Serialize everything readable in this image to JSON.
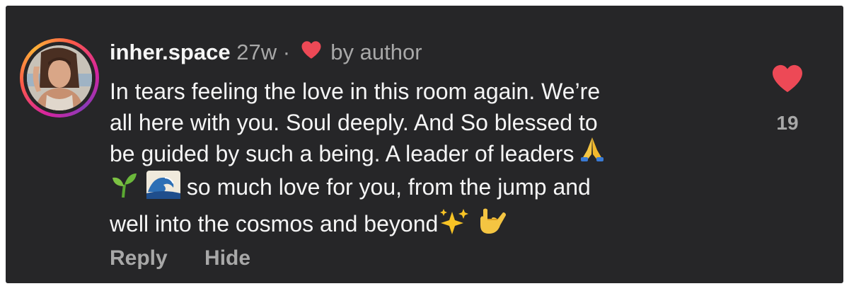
{
  "comment": {
    "username": "inher.space",
    "time_ago": "27w",
    "separator": "·",
    "author_badge": "by author",
    "author_badge_icon": "heart-icon",
    "text_lines": [
      "In tears feeling the love in this room again. We’re",
      "all here with you. Soul deeply. And So blessed to",
      "be guided by such a being. A leader of leaders",
      " so much love for you, from the jump and",
      "well into the cosmos and beyond"
    ],
    "emojis": [
      "folded-hands-emoji",
      "seedling-emoji",
      "wave-emoji",
      "sparkles-emoji",
      "love-you-gesture-emoji"
    ],
    "like_count": "19",
    "actions": {
      "reply": "Reply",
      "hide": "Hide"
    }
  },
  "colors": {
    "background": "#262628",
    "text": "#f5f5f5",
    "secondary_text": "#a8a8a8",
    "heart": "#ed4956"
  }
}
